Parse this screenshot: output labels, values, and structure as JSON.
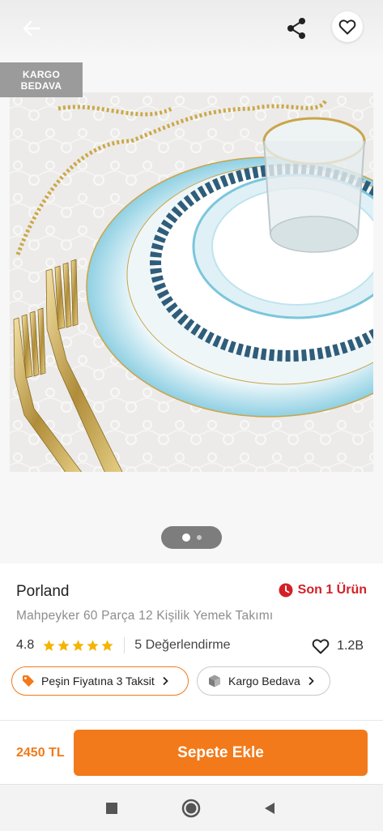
{
  "toolbar": {
    "back_icon": "arrow-left-icon",
    "share_icon": "share-icon",
    "favorite_icon": "heart-outline-icon"
  },
  "gallery": {
    "badge_line1": "KARGO",
    "badge_line2": "BEDAVA",
    "page_count": 2,
    "current_page": 1
  },
  "product": {
    "brand": "Porland",
    "stock_label": "Son 1 Ürün",
    "stock_icon": "clock-icon",
    "name": "Mahpeyker 60 Parça 12 Kişilik Yemek Takımı",
    "rating": "4.8",
    "stars": 5,
    "review_count": "5 Değerlendirme",
    "likes": "1.2B"
  },
  "chips": {
    "installment_label": "Peşin Fiyatına 3 Taksit",
    "installment_icon": "tag-icon",
    "shipping_label": "Kargo Bedava",
    "shipping_icon": "box-icon"
  },
  "cart": {
    "price": "2450 TL",
    "button_label": "Sepete Ekle"
  },
  "nav": {
    "recent_icon": "square-icon",
    "home_icon": "circle-icon",
    "back_icon": "triangle-back-icon"
  },
  "colors": {
    "accent": "#f27a1a",
    "stock_red": "#d32027",
    "star": "#f4b400"
  }
}
